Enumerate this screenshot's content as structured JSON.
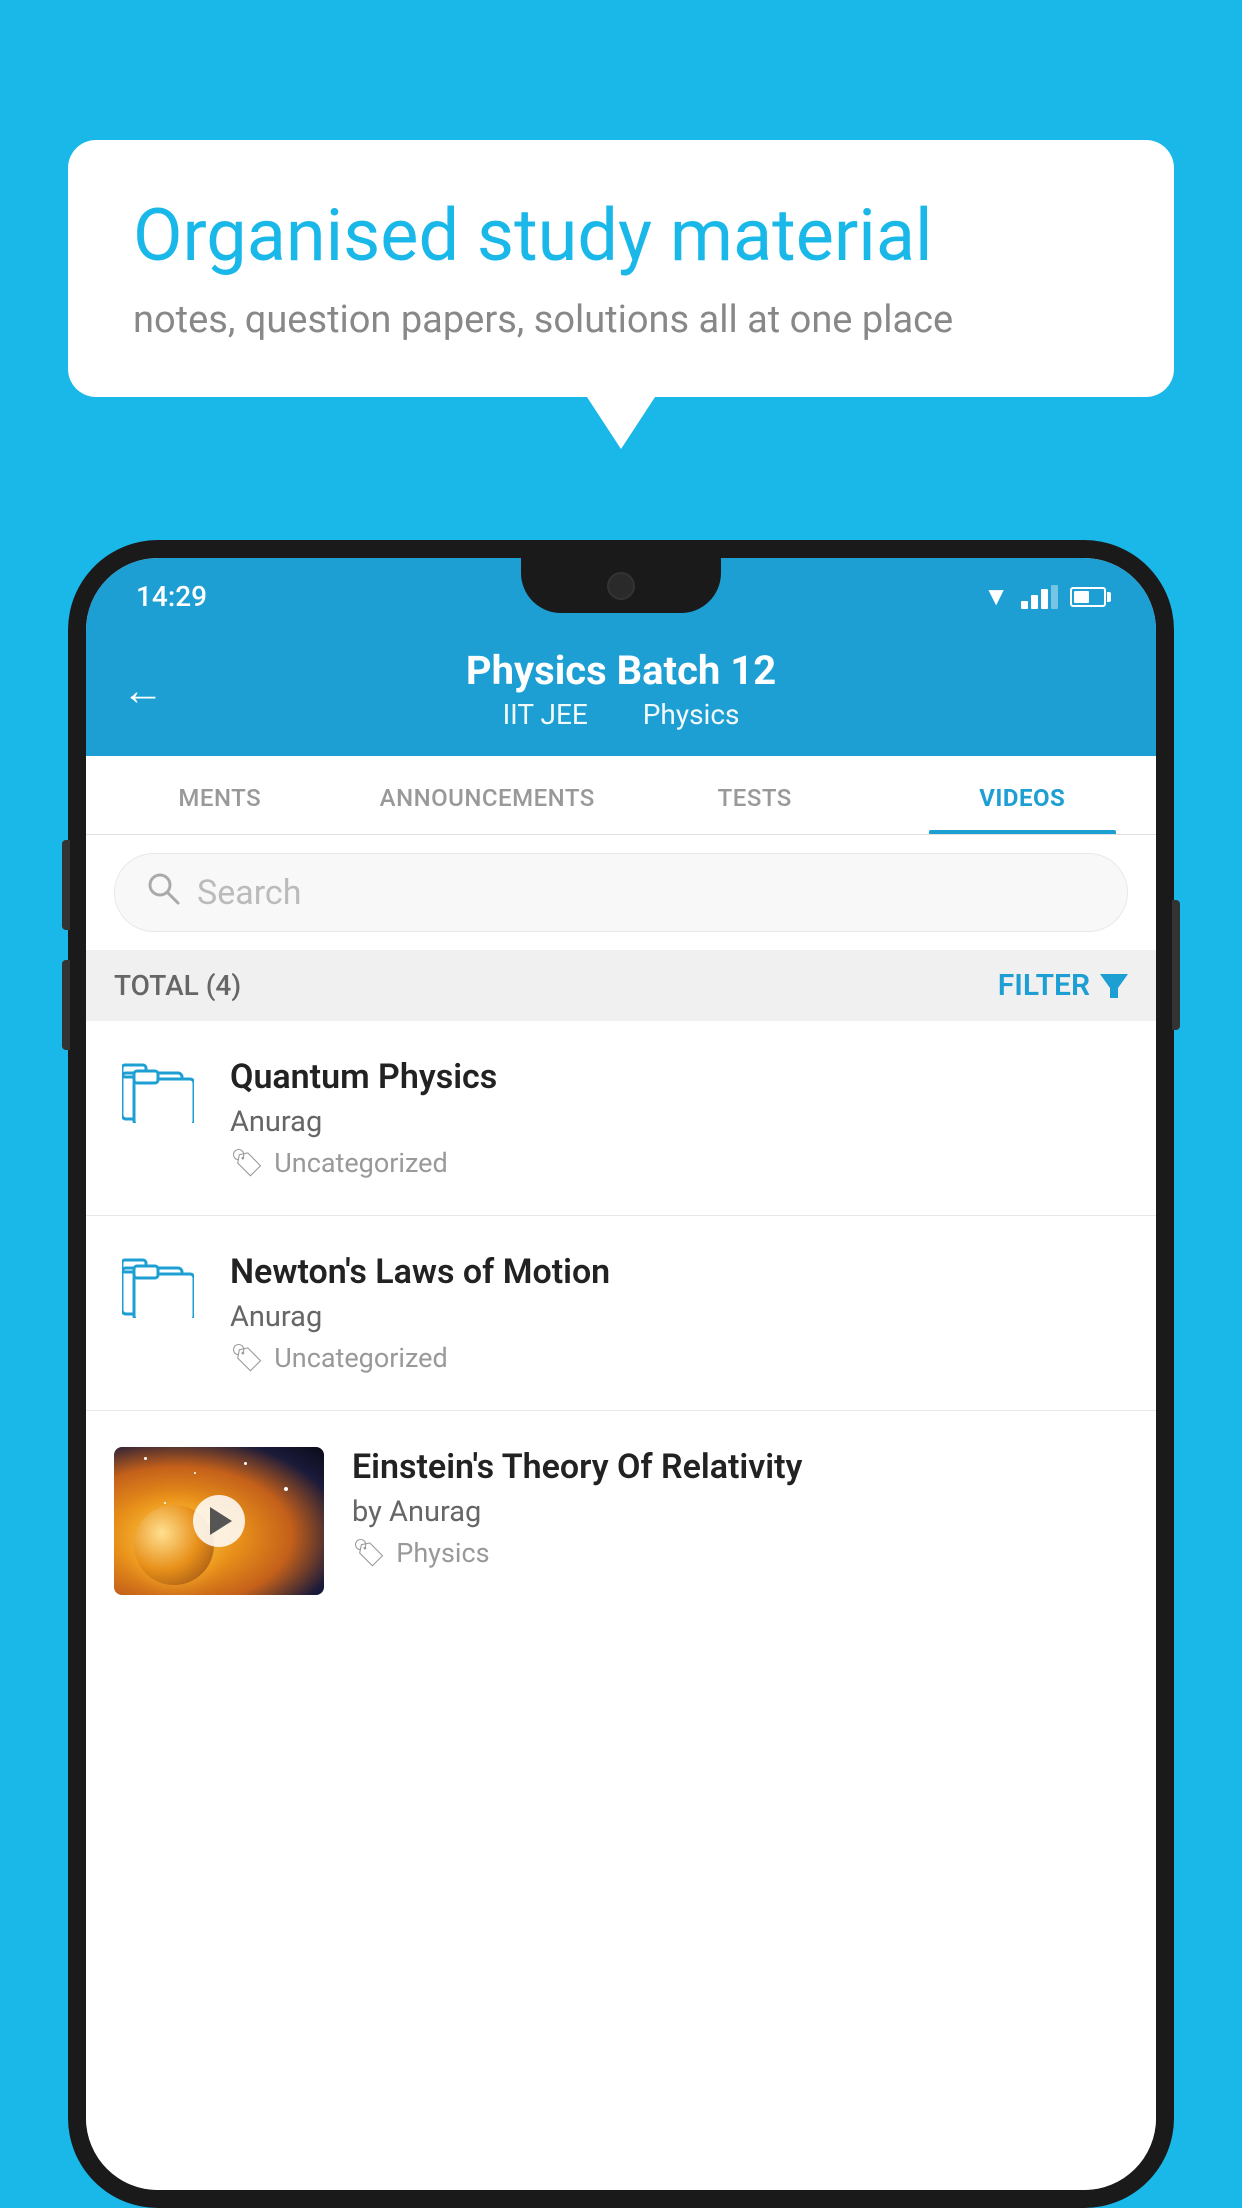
{
  "background_color": "#1ab8e8",
  "speech_bubble": {
    "title": "Organised study material",
    "subtitle": "notes, question papers, solutions all at one place"
  },
  "status_bar": {
    "time": "14:29"
  },
  "header": {
    "title": "Physics Batch 12",
    "subtitle_part1": "IIT JEE",
    "subtitle_part2": "Physics",
    "back_label": "←"
  },
  "tabs": [
    {
      "label": "MENTS",
      "active": false
    },
    {
      "label": "ANNOUNCEMENTS",
      "active": false
    },
    {
      "label": "TESTS",
      "active": false
    },
    {
      "label": "VIDEOS",
      "active": true
    }
  ],
  "search": {
    "placeholder": "Search"
  },
  "filter_bar": {
    "total_label": "TOTAL (4)",
    "filter_label": "FILTER"
  },
  "list_items": [
    {
      "title": "Quantum Physics",
      "author": "Anurag",
      "tag": "Uncategorized",
      "type": "folder"
    },
    {
      "title": "Newton's Laws of Motion",
      "author": "Anurag",
      "tag": "Uncategorized",
      "type": "folder"
    },
    {
      "title": "Einstein's Theory Of Relativity",
      "author": "by Anurag",
      "tag": "Physics",
      "type": "video"
    }
  ]
}
